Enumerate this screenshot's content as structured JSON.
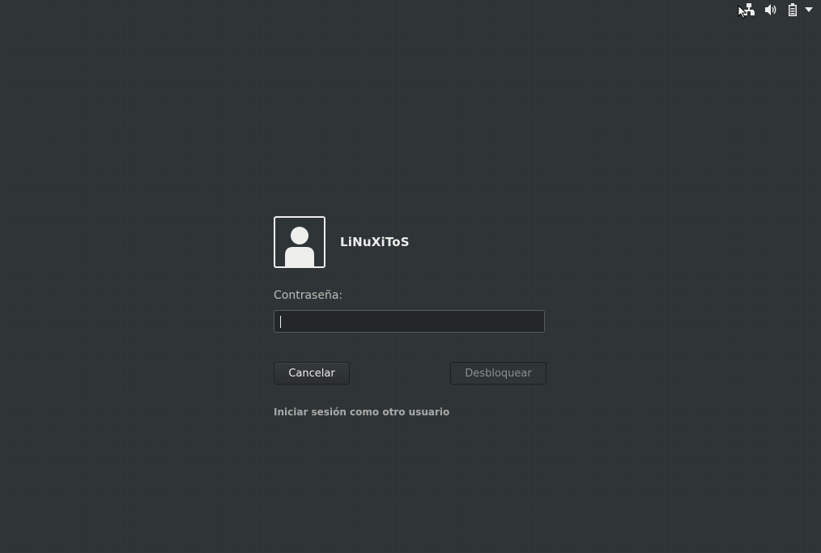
{
  "system_tray": {
    "icons": [
      "network-wired-icon",
      "volume-icon",
      "battery-icon",
      "system-menu-arrow-icon"
    ]
  },
  "user": {
    "avatar_icon": "user-avatar-icon",
    "name": "LiNuXiToS"
  },
  "password": {
    "label": "Contraseña:",
    "value": "",
    "placeholder": ""
  },
  "buttons": {
    "cancel_label": "Cancelar",
    "unlock_label": "Desbloquear"
  },
  "links": {
    "other_user_label": "Iniciar sesión como otro usuario"
  },
  "colors": {
    "background": "#2e3436",
    "text": "#eeeeec",
    "muted_text": "#babdb6",
    "disabled_text": "#8b8e8f"
  }
}
